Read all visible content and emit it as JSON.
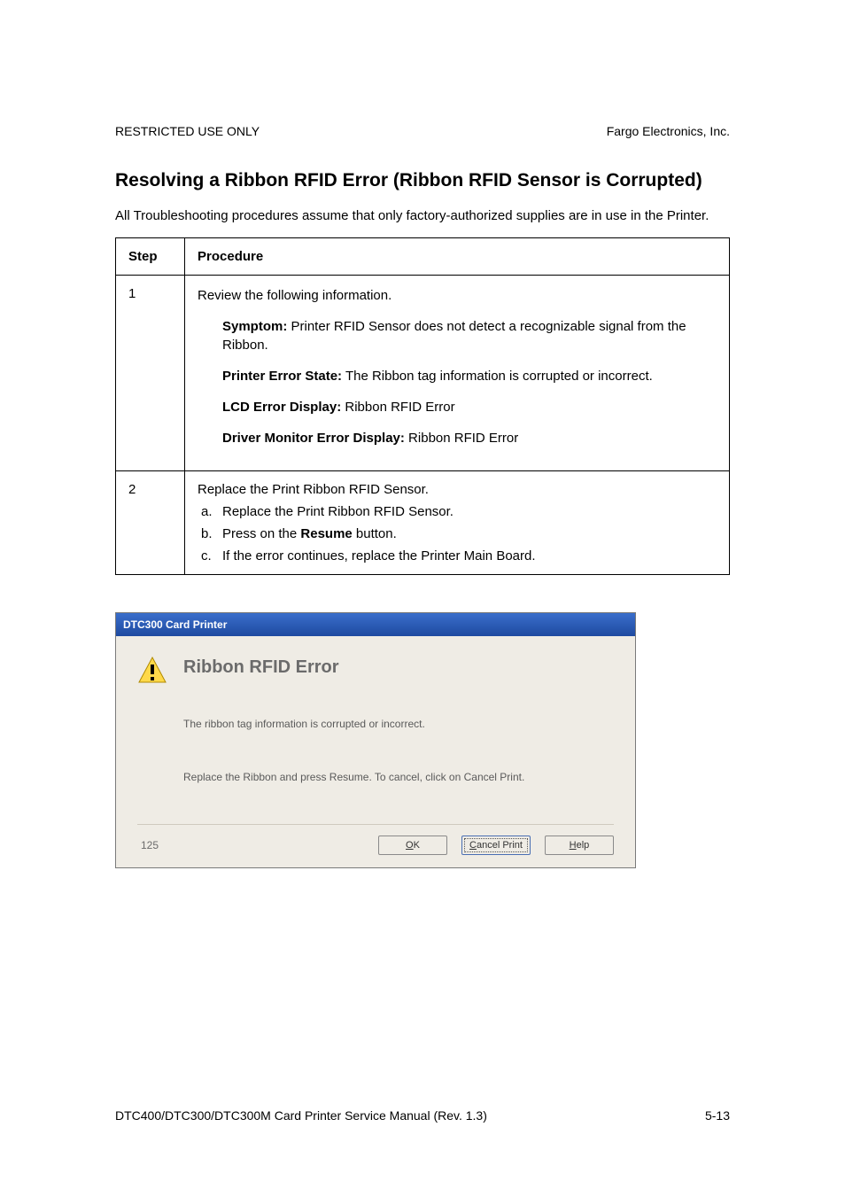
{
  "header": {
    "left": "RESTRICTED USE ONLY",
    "right": "Fargo Electronics, Inc."
  },
  "title": "Resolving a Ribbon RFID Error (Ribbon RFID Sensor is Corrupted)",
  "intro": "All Troubleshooting procedures assume that only factory-authorized supplies are in use in the Printer.",
  "table": {
    "head": {
      "step": "Step",
      "procedure": "Procedure"
    },
    "rows": [
      {
        "step": "1",
        "review": "Review the following information.",
        "symptom_label": "Symptom:",
        "symptom_text": " Printer RFID Sensor does not detect a recognizable signal from the Ribbon.",
        "state_label": "Printer Error State:",
        "state_text": " The Ribbon tag information is corrupted or incorrect.",
        "lcd_label": "LCD Error Display:",
        "lcd_text": " Ribbon RFID Error",
        "driver_label": "Driver Monitor Error Display:",
        "driver_text": " Ribbon RFID Error"
      },
      {
        "step": "2",
        "lead": "Replace the Print Ribbon RFID Sensor.",
        "items": [
          {
            "marker": "a.",
            "pre": "Replace the Print Ribbon RFID Sensor.",
            "bold": "",
            "post": ""
          },
          {
            "marker": "b.",
            "pre": "Press on the ",
            "bold": "Resume",
            "post": " button."
          },
          {
            "marker": "c.",
            "pre": "If the error continues, replace the Printer Main Board.",
            "bold": "",
            "post": ""
          }
        ]
      }
    ]
  },
  "dialog": {
    "title": "DTC300 Card Printer",
    "heading": "Ribbon RFID Error",
    "line1": "The ribbon tag information is corrupted or incorrect.",
    "line2": "Replace the Ribbon and press Resume. To cancel, click on Cancel Print.",
    "counter": "125",
    "buttons": {
      "ok_u": "O",
      "ok_rest": "K",
      "cancel_u": "C",
      "cancel_rest": "ancel Print",
      "help_u": "H",
      "help_rest": "elp"
    }
  },
  "footer": {
    "left": "DTC400/DTC300/DTC300M Card Printer Service Manual (Rev. 1.3)",
    "right": "5-13"
  }
}
